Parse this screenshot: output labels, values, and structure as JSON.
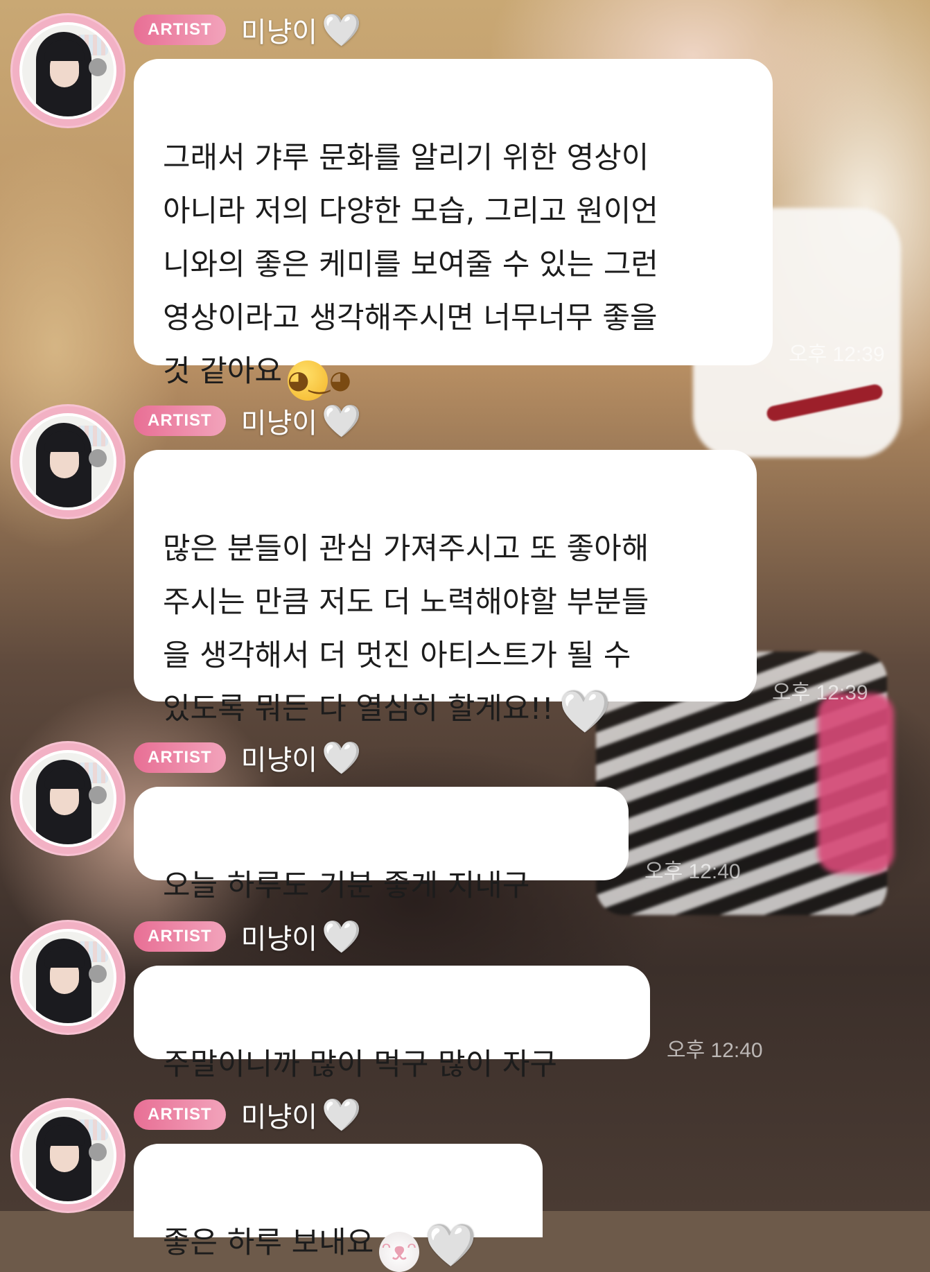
{
  "chat": {
    "messages": [
      {
        "badge": "ARTIST",
        "sender": "미냥이",
        "heart": "🤍",
        "text": "그래서 갸루 문화를 알리기 위한 영상이\n아니라 저의 다양한 모습, 그리고 원이언\n니와의 좋은 케미를 보여줄 수 있는 그런\n영상이라고 생각해주시면 너무너무 좋을\n것 같아요",
        "emoji": "🫣",
        "time": "오후 12:39"
      },
      {
        "badge": "ARTIST",
        "sender": "미냥이",
        "heart": "🤍",
        "text": "많은 분들이 관심 가져주시고 또 좋아해\n주시는 만큼 저도 더 노력해야할 부분들\n을 생각해서 더 멋진 아티스트가 될 수\n있도록 뭐든 다 열심히 할게요!!",
        "emoji": "🤍",
        "time": "오후 12:39"
      },
      {
        "badge": "ARTIST",
        "sender": "미냥이",
        "heart": "🤍",
        "text": "오늘 하루도 기분 좋게 지내구",
        "emoji": "",
        "time": "오후 12:40"
      },
      {
        "badge": "ARTIST",
        "sender": "미냥이",
        "heart": "🤍",
        "text": "주말이니까 많이 먹구 많이 자구",
        "emoji": "",
        "time": "오후 12:40"
      },
      {
        "badge": "ARTIST",
        "sender": "미냥이",
        "heart": "🤍",
        "text": "좋은 하루 보내요",
        "emoji": "🐰🤍",
        "time": ""
      }
    ]
  },
  "colors": {
    "badge_start": "#e86f95",
    "badge_end": "#f2a3bb",
    "bubble": "#ffffff",
    "avatar_ring": "#f2b1c4"
  },
  "icons": {
    "sender_heart": "white-heart-icon",
    "avatar": "profile-avatar"
  }
}
